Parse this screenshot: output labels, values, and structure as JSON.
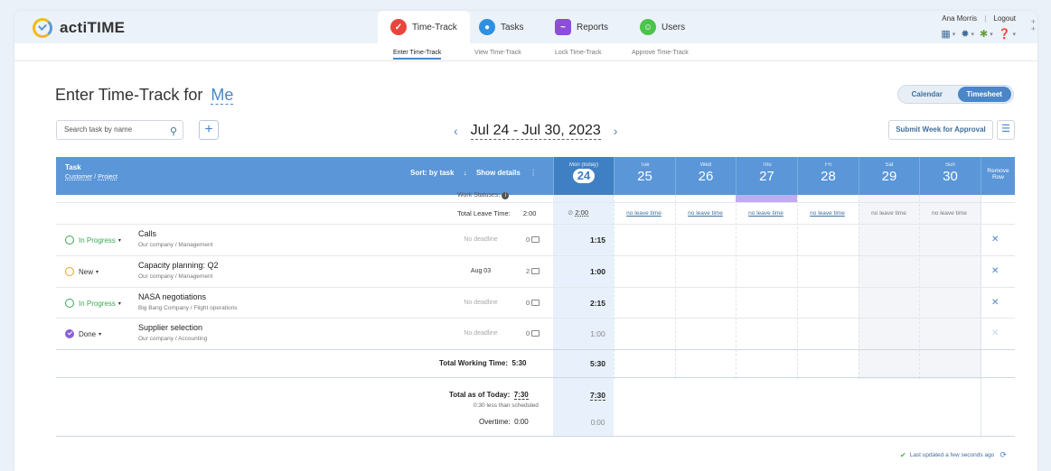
{
  "app": {
    "logo_text": "actiTIME"
  },
  "modules": [
    {
      "label": "Time-Track",
      "icon": "time-track-icon",
      "color": "#e8453c"
    },
    {
      "label": "Tasks",
      "icon": "tasks-icon",
      "color": "#2f8fe0"
    },
    {
      "label": "Reports",
      "icon": "reports-icon",
      "color": "#8a4fd6"
    },
    {
      "label": "Users",
      "icon": "users-icon",
      "color": "#4cc34c"
    }
  ],
  "user": {
    "name": "Ana Morris",
    "logout": "Logout"
  },
  "subnav": [
    "Enter Time-Track",
    "View Time-Track",
    "Lock Time-Track",
    "Approve Time-Track"
  ],
  "page": {
    "title": "Enter Time-Track for",
    "title_user": "Me",
    "view_calendar": "Calendar",
    "view_timesheet": "Timesheet"
  },
  "search": {
    "placeholder": "Search task by name"
  },
  "week": {
    "range": "Jul 24 - Jul 30, 2023",
    "prev": "‹",
    "next": "›"
  },
  "submit_label": "Submit Week for Approval",
  "header": {
    "task": "Task",
    "customer": "Customer",
    "project": "Project",
    "sort": "Sort: by task",
    "show_details": "Show details",
    "remove_row": "Remove Row"
  },
  "days": [
    {
      "name": "Mon (today)",
      "num": "24"
    },
    {
      "name": "Tue",
      "num": "25"
    },
    {
      "name": "Wed",
      "num": "26"
    },
    {
      "name": "Thu",
      "num": "27"
    },
    {
      "name": "Fri",
      "num": "28"
    },
    {
      "name": "Sat",
      "num": "29"
    },
    {
      "name": "Sun",
      "num": "30"
    }
  ],
  "work_statuses_label": "Work Statuses:",
  "leave": {
    "label": "Total Leave Time:",
    "total": "2:00",
    "today": "2:00",
    "no_leave": "no leave time"
  },
  "tasks": [
    {
      "status": "In Progress",
      "name": "Calls",
      "sub": "Our company / Management",
      "deadline": "No deadline",
      "comments": "0",
      "today": "1:15"
    },
    {
      "status": "New",
      "name": "Capacity planning: Q2",
      "sub": "Our company / Management",
      "deadline": "Aug 03",
      "comments": "2",
      "today": "1:00"
    },
    {
      "status": "In Progress",
      "name": "NASA negotiations",
      "sub": "Big Bang Company / Flight operations",
      "deadline": "No deadline",
      "comments": "0",
      "today": "2:15"
    },
    {
      "status": "Done",
      "name": "Supplier selection",
      "sub": "Our company / Accounting",
      "deadline": "No deadline",
      "comments": "0",
      "today": "1:00"
    }
  ],
  "totals": {
    "working_label": "Total Working Time:",
    "working_total": "5:30",
    "working_today": "5:30",
    "asof_label": "Total as of Today:",
    "asof_total": "7:30",
    "asof_today": "7:30",
    "asof_note": "0:30 less than scheduled",
    "overtime_label": "Overtime:",
    "overtime_total": "0:00",
    "overtime_today": "0:00"
  },
  "updated": "Last updated a few seconds ago",
  "colors": {
    "header_blue": "#5a96d8",
    "today_column": "#e8f1fb",
    "weekend_column": "#f3f5f8",
    "status_in_progress": "#3aa757",
    "status_new": "#f0a020",
    "status_done": "#8b5fd8",
    "thursday_status": "#c5a9f0"
  }
}
